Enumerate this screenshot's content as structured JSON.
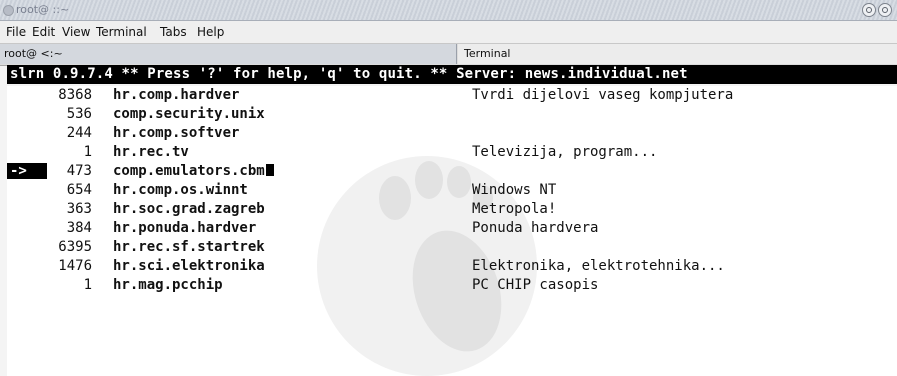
{
  "window": {
    "title": "root@ ::~"
  },
  "menubar": {
    "items": [
      "File",
      "Edit",
      "View",
      "Terminal",
      "Tabs",
      "Help"
    ]
  },
  "tabs": [
    {
      "label": "root@   <:~"
    },
    {
      "label": "Terminal"
    }
  ],
  "terminal": {
    "status_line": "slrn 0.9.7.4 ** Press '?' for help, 'q' to quit. ** Server: news.individual.net",
    "cursor_label": "->",
    "groups": [
      {
        "count": "8368",
        "name": "hr.comp.hardver",
        "description": "Tvrdi dijelovi vaseg kompjutera"
      },
      {
        "count": "536",
        "name": "comp.security.unix",
        "description": ""
      },
      {
        "count": "244",
        "name": "hr.comp.softver",
        "description": ""
      },
      {
        "count": "1",
        "name": "hr.rec.tv",
        "description": "Televizija, program..."
      },
      {
        "count": "473",
        "name": "comp.emulators.cbm",
        "description": ""
      },
      {
        "count": "654",
        "name": "hr.comp.os.winnt",
        "description": "Windows NT"
      },
      {
        "count": "363",
        "name": "hr.soc.grad.zagreb",
        "description": "Metropola!"
      },
      {
        "count": "384",
        "name": "hr.ponuda.hardver",
        "description": "Ponuda hardvera"
      },
      {
        "count": "6395",
        "name": "hr.rec.sf.startrek",
        "description": ""
      },
      {
        "count": "1476",
        "name": "hr.sci.elektronika",
        "description": "Elektronika, elektrotehnika..."
      },
      {
        "count": "1",
        "name": "hr.mag.pcchip",
        "description": "PC CHIP casopis"
      }
    ],
    "selected_index": 4
  },
  "colors": {
    "terminal_bg": "#ffffff",
    "status_bg": "#000000",
    "status_fg": "#ffffff"
  }
}
